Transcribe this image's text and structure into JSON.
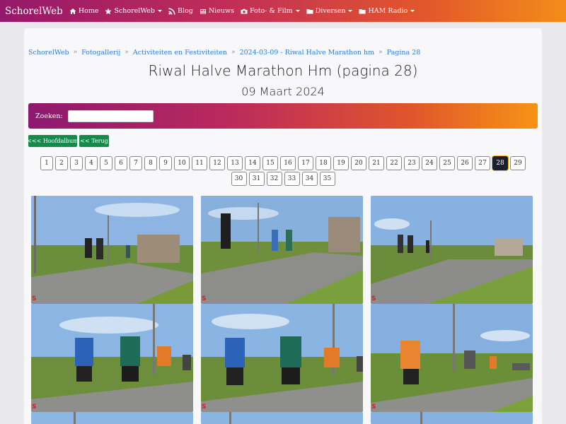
{
  "navbar": {
    "brand": "SchorelWeb",
    "items": [
      {
        "label": "Home",
        "icon": "home-icon",
        "dropdown": false
      },
      {
        "label": "SchorelWeb",
        "icon": "star-icon",
        "dropdown": true
      },
      {
        "label": "Blog",
        "icon": "rss-icon",
        "dropdown": false
      },
      {
        "label": "Nieuws",
        "icon": "newspaper-icon",
        "dropdown": false
      },
      {
        "label": "Foto- & Film",
        "icon": "camera-icon",
        "dropdown": true
      },
      {
        "label": "Diversen",
        "icon": "folder-icon",
        "dropdown": true
      },
      {
        "label": "HAM Radio",
        "icon": "folder-icon",
        "dropdown": true
      }
    ]
  },
  "breadcrumb": [
    "SchorelWeb",
    "Fotogallerij",
    "Activiteiten en Festiviteiten",
    "2024-03-09 - Riwal Halve Marathon hm",
    "Pagina 28"
  ],
  "breadcrumb_separator": "»",
  "page": {
    "title": "Riwal Halve Marathon Hm (pagina 28)",
    "date": "09 Maart 2024"
  },
  "search": {
    "label": "Zoeken:",
    "value": ""
  },
  "buttons": {
    "hoofdalbum": "<<< Hoofdalbum",
    "terug": "<< Terug"
  },
  "pagination": {
    "row1": [
      "1",
      "2",
      "3",
      "4",
      "5",
      "6",
      "7",
      "8",
      "9",
      "10",
      "11",
      "12",
      "13",
      "14",
      "15",
      "16",
      "17",
      "18",
      "19",
      "20",
      "21",
      "22",
      "23",
      "24",
      "25",
      "26",
      "27",
      "28",
      "29"
    ],
    "row2": [
      "30",
      "31",
      "32",
      "33",
      "34",
      "35"
    ],
    "current": "28"
  },
  "watermark": "S",
  "colors": {
    "navbar_gradient": [
      "#94186b",
      "#f38d1a"
    ],
    "link": "#2a7de1",
    "button_green": "#148a4b",
    "active_page": "#1c1f2d"
  }
}
